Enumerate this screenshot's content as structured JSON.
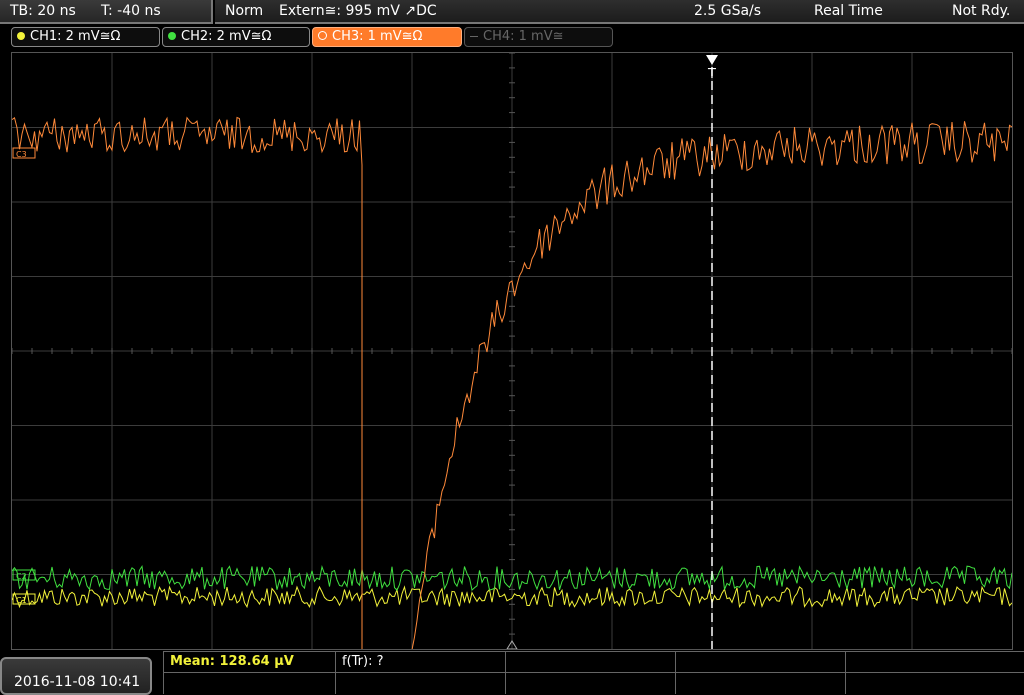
{
  "status": {
    "timebase": "TB: 20 ns",
    "trigger_offset": "T: -40 ns",
    "mode": "Norm",
    "trigger_source": "Extern≅: 995 mV ↗DC",
    "sample_rate": "2.5 GSa/s",
    "acquisition": "Real Time",
    "ready": "Not Rdy."
  },
  "channels": [
    {
      "label": "CH1: 2 mV≅Ω",
      "color": "#f2f23a",
      "active": true
    },
    {
      "label": "CH2: 2 mV≅Ω",
      "color": "#40e040",
      "active": true
    },
    {
      "label": "CH3: 1 mV≅Ω",
      "color": "#ff8a3a",
      "active": true,
      "selected": true
    },
    {
      "label": "CH4: 1 mV≅",
      "color": "#6a6a6a",
      "active": false
    }
  ],
  "markers": {
    "trigger": "T",
    "ch3": "C3",
    "ch2": "C2",
    "ch1": "C1"
  },
  "measurements": {
    "mean": "Mean: 128.64 µV",
    "rise_time": "f(Tr): ?"
  },
  "datetime": "2016-11-08 10:41",
  "chart_data": {
    "type": "line",
    "grid": "10 x 8 divisions",
    "timebase_per_div": "20 ns",
    "trigger_offset_ns": -40,
    "series": [
      {
        "name": "CH3",
        "description_levels": {
          "baseline_before_step_div": 1.1,
          "drop_at_div": 3.5,
          "final_level_div": 1.2,
          "rise_end_div": 7.0
        }
      },
      {
        "name": "CH2",
        "level_div": 7.05
      },
      {
        "name": "CH1",
        "level_div": 7.3
      }
    ]
  }
}
